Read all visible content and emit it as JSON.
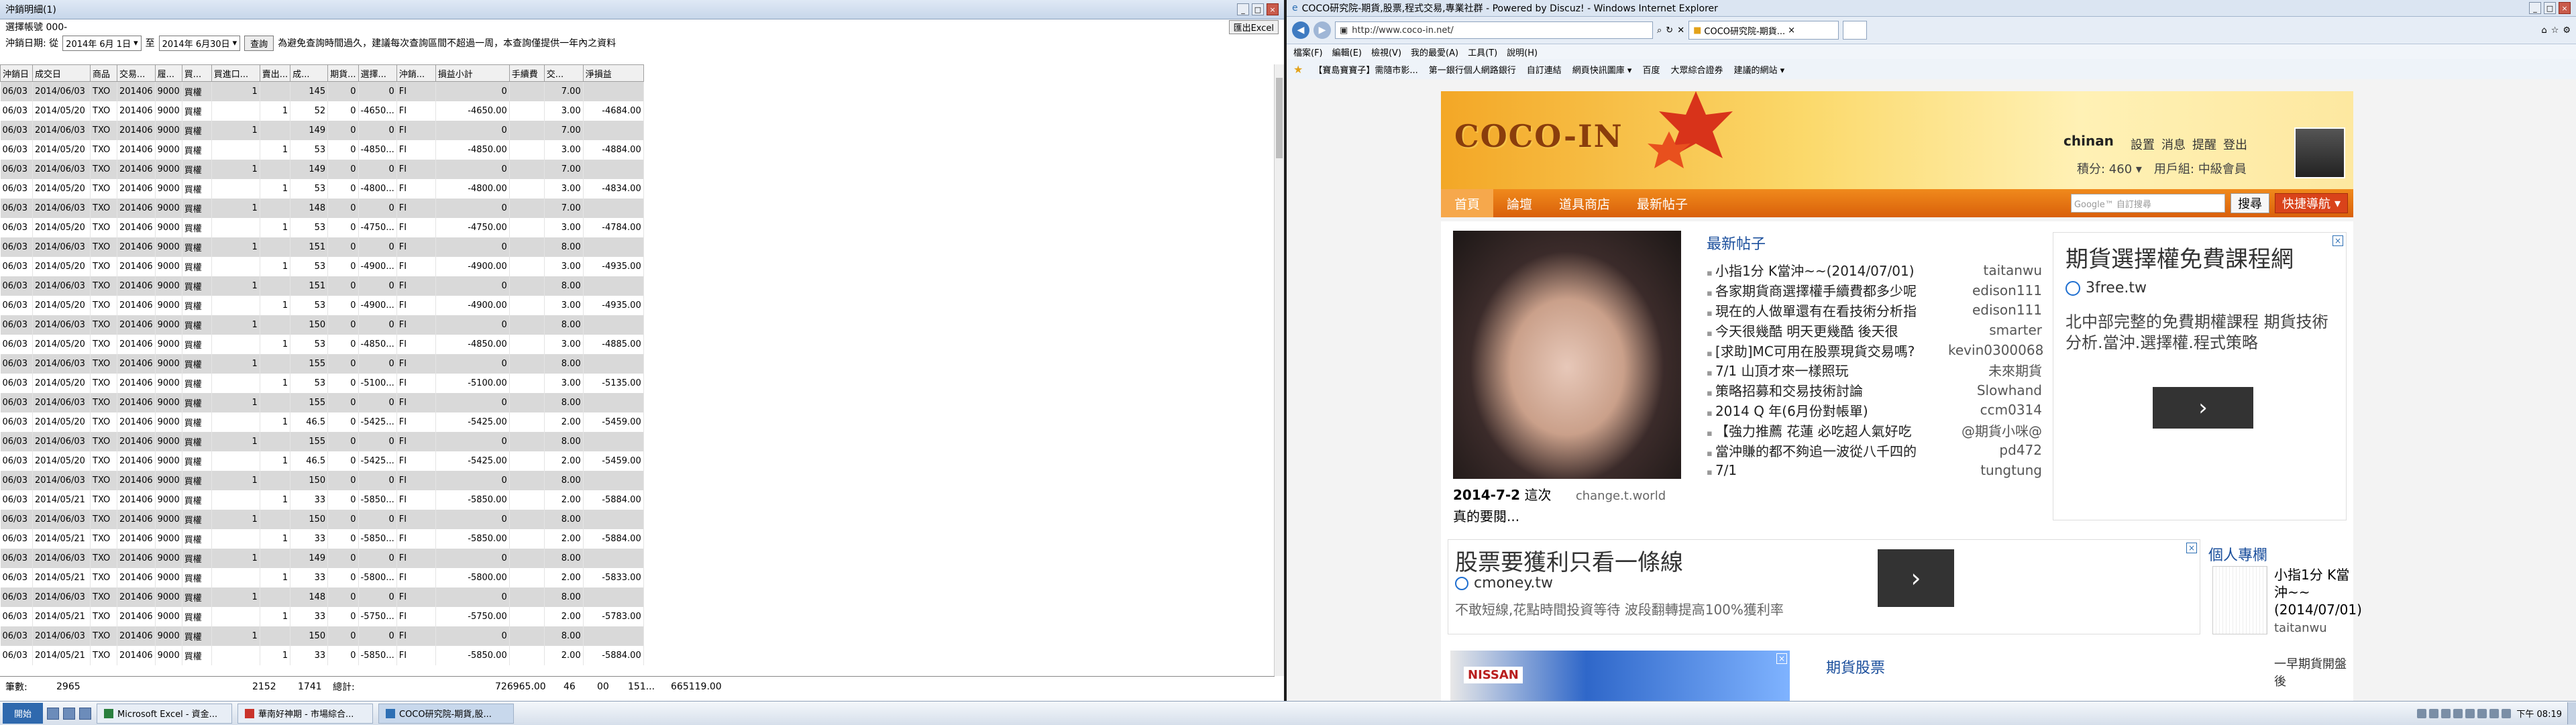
{
  "left_window": {
    "title": "沖銷明細(1)",
    "account_label": "選擇帳號 000-",
    "export_label": "匯出Excel",
    "date_label": "沖銷日期: 從",
    "date_from": "2014年 6月 1日",
    "to_label": "至",
    "date_to": "2014年 6月30日",
    "query_label": "查詢",
    "notice": "為避免查詢時間過久，建議每次查詢區間不超過一周，本查詢僅提供一年內之資料",
    "columns": [
      "沖銷日",
      "成交日",
      "商品",
      "交易...",
      "履...",
      "買...",
      "買進口...",
      "賣出...",
      "成...",
      "期貨...",
      "選擇...",
      "沖銷...",
      "損益小計",
      "手續費",
      "交...",
      "淨損益"
    ],
    "rows": [
      [
        "06/03",
        "2014/06/03",
        "TXO",
        "201406",
        "9000",
        "買權",
        "1",
        "",
        "145",
        "0",
        "0",
        "FI",
        "0",
        "",
        "7.00",
        ""
      ],
      [
        "06/03",
        "2014/05/20",
        "TXO",
        "201406",
        "9000",
        "買權",
        "",
        "1",
        "52",
        "0",
        "-4650...",
        "FI",
        "-4650.00",
        "",
        "3.00",
        "-4684.00"
      ],
      [
        "06/03",
        "2014/06/03",
        "TXO",
        "201406",
        "9000",
        "買權",
        "1",
        "",
        "149",
        "0",
        "0",
        "FI",
        "0",
        "",
        "7.00",
        ""
      ],
      [
        "06/03",
        "2014/05/20",
        "TXO",
        "201406",
        "9000",
        "買權",
        "",
        "1",
        "53",
        "0",
        "-4850...",
        "FI",
        "-4850.00",
        "",
        "3.00",
        "-4884.00"
      ],
      [
        "06/03",
        "2014/06/03",
        "TXO",
        "201406",
        "9000",
        "買權",
        "1",
        "",
        "149",
        "0",
        "0",
        "FI",
        "0",
        "",
        "7.00",
        ""
      ],
      [
        "06/03",
        "2014/05/20",
        "TXO",
        "201406",
        "9000",
        "買權",
        "",
        "1",
        "53",
        "0",
        "-4800...",
        "FI",
        "-4800.00",
        "",
        "3.00",
        "-4834.00"
      ],
      [
        "06/03",
        "2014/06/03",
        "TXO",
        "201406",
        "9000",
        "買權",
        "1",
        "",
        "148",
        "0",
        "0",
        "FI",
        "0",
        "",
        "7.00",
        ""
      ],
      [
        "06/03",
        "2014/05/20",
        "TXO",
        "201406",
        "9000",
        "買權",
        "",
        "1",
        "53",
        "0",
        "-4750...",
        "FI",
        "-4750.00",
        "",
        "3.00",
        "-4784.00"
      ],
      [
        "06/03",
        "2014/06/03",
        "TXO",
        "201406",
        "9000",
        "買權",
        "1",
        "",
        "151",
        "0",
        "0",
        "FI",
        "0",
        "",
        "8.00",
        ""
      ],
      [
        "06/03",
        "2014/05/20",
        "TXO",
        "201406",
        "9000",
        "買權",
        "",
        "1",
        "53",
        "0",
        "-4900...",
        "FI",
        "-4900.00",
        "",
        "3.00",
        "-4935.00"
      ],
      [
        "06/03",
        "2014/06/03",
        "TXO",
        "201406",
        "9000",
        "買權",
        "1",
        "",
        "151",
        "0",
        "0",
        "FI",
        "0",
        "",
        "8.00",
        ""
      ],
      [
        "06/03",
        "2014/05/20",
        "TXO",
        "201406",
        "9000",
        "買權",
        "",
        "1",
        "53",
        "0",
        "-4900...",
        "FI",
        "-4900.00",
        "",
        "3.00",
        "-4935.00"
      ],
      [
        "06/03",
        "2014/06/03",
        "TXO",
        "201406",
        "9000",
        "買權",
        "1",
        "",
        "150",
        "0",
        "0",
        "FI",
        "0",
        "",
        "8.00",
        ""
      ],
      [
        "06/03",
        "2014/05/20",
        "TXO",
        "201406",
        "9000",
        "買權",
        "",
        "1",
        "53",
        "0",
        "-4850...",
        "FI",
        "-4850.00",
        "",
        "3.00",
        "-4885.00"
      ],
      [
        "06/03",
        "2014/06/03",
        "TXO",
        "201406",
        "9000",
        "買權",
        "1",
        "",
        "155",
        "0",
        "0",
        "FI",
        "0",
        "",
        "8.00",
        ""
      ],
      [
        "06/03",
        "2014/05/20",
        "TXO",
        "201406",
        "9000",
        "買權",
        "",
        "1",
        "53",
        "0",
        "-5100...",
        "FI",
        "-5100.00",
        "",
        "3.00",
        "-5135.00"
      ],
      [
        "06/03",
        "2014/06/03",
        "TXO",
        "201406",
        "9000",
        "買權",
        "1",
        "",
        "155",
        "0",
        "0",
        "FI",
        "0",
        "",
        "8.00",
        ""
      ],
      [
        "06/03",
        "2014/05/20",
        "TXO",
        "201406",
        "9000",
        "買權",
        "",
        "1",
        "46.5",
        "0",
        "-5425...",
        "FI",
        "-5425.00",
        "",
        "2.00",
        "-5459.00"
      ],
      [
        "06/03",
        "2014/06/03",
        "TXO",
        "201406",
        "9000",
        "買權",
        "1",
        "",
        "155",
        "0",
        "0",
        "FI",
        "0",
        "",
        "8.00",
        ""
      ],
      [
        "06/03",
        "2014/05/20",
        "TXO",
        "201406",
        "9000",
        "買權",
        "",
        "1",
        "46.5",
        "0",
        "-5425...",
        "FI",
        "-5425.00",
        "",
        "2.00",
        "-5459.00"
      ],
      [
        "06/03",
        "2014/06/03",
        "TXO",
        "201406",
        "9000",
        "買權",
        "1",
        "",
        "150",
        "0",
        "0",
        "FI",
        "0",
        "",
        "8.00",
        ""
      ],
      [
        "06/03",
        "2014/05/21",
        "TXO",
        "201406",
        "9000",
        "買權",
        "",
        "1",
        "33",
        "0",
        "-5850...",
        "FI",
        "-5850.00",
        "",
        "2.00",
        "-5884.00"
      ],
      [
        "06/03",
        "2014/06/03",
        "TXO",
        "201406",
        "9000",
        "買權",
        "1",
        "",
        "150",
        "0",
        "0",
        "FI",
        "0",
        "",
        "8.00",
        ""
      ],
      [
        "06/03",
        "2014/05/21",
        "TXO",
        "201406",
        "9000",
        "買權",
        "",
        "1",
        "33",
        "0",
        "-5850...",
        "FI",
        "-5850.00",
        "",
        "2.00",
        "-5884.00"
      ],
      [
        "06/03",
        "2014/06/03",
        "TXO",
        "201406",
        "9000",
        "買權",
        "1",
        "",
        "149",
        "0",
        "0",
        "FI",
        "0",
        "",
        "8.00",
        ""
      ],
      [
        "06/03",
        "2014/05/21",
        "TXO",
        "201406",
        "9000",
        "買權",
        "",
        "1",
        "33",
        "0",
        "-5800...",
        "FI",
        "-5800.00",
        "",
        "2.00",
        "-5833.00"
      ],
      [
        "06/03",
        "2014/06/03",
        "TXO",
        "201406",
        "9000",
        "買權",
        "1",
        "",
        "148",
        "0",
        "0",
        "FI",
        "0",
        "",
        "8.00",
        ""
      ],
      [
        "06/03",
        "2014/05/21",
        "TXO",
        "201406",
        "9000",
        "買權",
        "",
        "1",
        "33",
        "0",
        "-5750...",
        "FI",
        "-5750.00",
        "",
        "2.00",
        "-5783.00"
      ],
      [
        "06/03",
        "2014/06/03",
        "TXO",
        "201406",
        "9000",
        "買權",
        "1",
        "",
        "150",
        "0",
        "0",
        "FI",
        "0",
        "",
        "8.00",
        ""
      ],
      [
        "06/03",
        "2014/05/21",
        "TXO",
        "201406",
        "9000",
        "買權",
        "",
        "1",
        "33",
        "0",
        "-5850...",
        "FI",
        "-5850.00",
        "",
        "2.00",
        "-5884.00"
      ]
    ],
    "status": {
      "count_label": "筆數:",
      "count": "2965",
      "buy_total": "2152",
      "sell_total": "1741",
      "total_label": "總計:",
      "pnl_total": "726965.00",
      "fee_partial": "46",
      "tax_partial": "00",
      "tx_total": "151...",
      "net_total": "665119.00"
    }
  },
  "browser": {
    "title": "COCO研究院-期貨,股票,程式交易,專業社群 - Powered by Discuz! - Windows Internet Explorer",
    "address": "http://www.coco-in.net/",
    "tab_label": "COCO研究院-期貨...",
    "menu": [
      "檔案(F)",
      "編輯(E)",
      "檢視(V)",
      "我的最愛(A)",
      "工具(T)",
      "說明(H)"
    ],
    "favorites": [
      "【寶島寶寶子】需隨市影...",
      "第一銀行個人網路銀行",
      "自訂連結",
      "網頁快訊圖庫 ▾",
      "百度",
      "大眾綜合證券",
      "建議的網站 ▾"
    ],
    "site": {
      "logo": "COCO-IN",
      "username": "chinan",
      "user_links": [
        "設置",
        "消息",
        "提醒",
        "登出"
      ],
      "points_label": "積分: 460 ▾",
      "group_label": "用戶組: 中級會員",
      "nav": [
        "首頁",
        "論壇",
        "道具商店",
        "最新帖子"
      ],
      "search_placeholder": "Google™ 自訂搜尋",
      "search_btn": "搜尋",
      "quick_nav": "快捷導航",
      "photo_date": "2014-7-2",
      "photo_caption1": "這次",
      "photo_author": "change.t.world",
      "photo_caption2": "真的要閱...",
      "posts_title": "最新帖子",
      "posts": [
        {
          "title": "小指1分 K當沖~~(2014/07/01)",
          "author": "taitanwu"
        },
        {
          "title": "各家期貨商選擇權手續費都多少呢",
          "author": "edison111"
        },
        {
          "title": "現在的人做單還有在看技術分析指",
          "author": "edison111"
        },
        {
          "title": "今天很幾酷 明天更幾酷 後天很",
          "author": "smarter"
        },
        {
          "title": "[求助]MC可用在股票現貨交易嗎?",
          "author": "kevin0300068"
        },
        {
          "title": "7/1 山頂才來一樣照玩",
          "author": "未來期貨"
        },
        {
          "title": "策略招募和交易技術討論",
          "author": "Slowhand"
        },
        {
          "title": "2014 Q 年(6月份對帳單)",
          "author": "ccm0314"
        },
        {
          "title": "【強力推薦 花蓮 必吃超人氣好吃",
          "author": "@期貨小咪@"
        },
        {
          "title": "當沖賺的都不夠追一波從八千四的",
          "author": "pd472"
        },
        {
          "title": "7/1",
          "author": "tungtung"
        }
      ],
      "ad1_title": "期貨選擇權免費課程網",
      "ad1_url": "3free.tw",
      "ad1_desc": "北中部完整的免費期權課程 期貨技術分析.當沖.選擇權.程式策略",
      "ad1_btn": "›",
      "ad2_title": "股票要獲利只看一條線",
      "ad2_url": "cmoney.tw",
      "ad2_desc": "不敢短線,花點時間投資等待 波段翻轉提高100%獲利率",
      "ad2_btn": "›",
      "personal_title": "個人專欄",
      "side_post": "小指1分 K當沖~~(2014/07/01)",
      "side_author": "taitanwu",
      "side_post2": "一早期貨開盤後",
      "ad3_brand": "NISSAN",
      "stock_title": "期貨股票"
    }
  },
  "taskbar": {
    "start": "開始",
    "items": [
      "Microsoft Excel - 資金...",
      "華南好神期 - 市場綜合...",
      "COCO研究院-期貨,股..."
    ],
    "clock": "下午 08:19"
  }
}
